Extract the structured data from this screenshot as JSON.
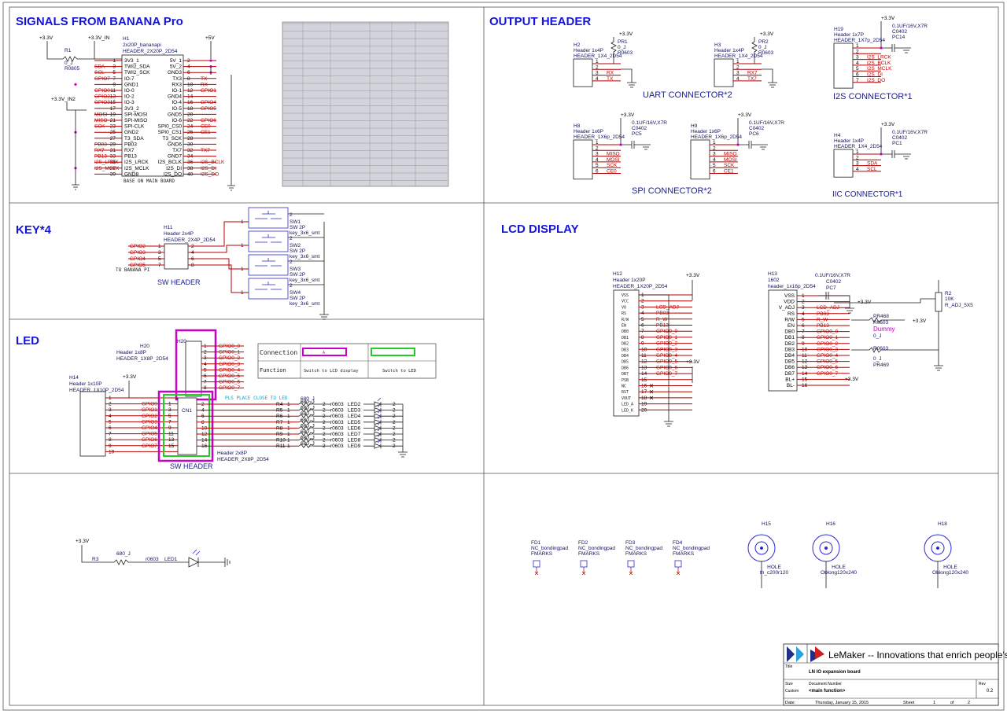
{
  "sections": {
    "signals": "SIGNALS FROM BANANA Pro",
    "output": "OUTPUT HEADER",
    "key": "KEY*4",
    "lcd": "LCD DISPLAY",
    "led": "LED"
  },
  "h1": {
    "ref": "H1",
    "val": "2x20P_bananapi",
    "fp": "HEADER_2X20P_2D54",
    "note": "BASE ON MAIN BOARD",
    "r1": [
      "R1",
      "0_J",
      "R0805"
    ],
    "power": [
      "+3.3V",
      "+3.3V_IN",
      "+5V",
      "+3.3V_IN2"
    ],
    "left": [
      {
        "n": "1",
        "p": "3V3_1",
        "s": ""
      },
      {
        "n": "3",
        "p": "TWI2_SDA",
        "s": "SDA"
      },
      {
        "n": "5",
        "p": "TWI2_SCK",
        "s": "SCL"
      },
      {
        "n": "7",
        "p": "IO-7",
        "s": "GPIO7"
      },
      {
        "n": "9",
        "p": "GND1",
        "s": ""
      },
      {
        "n": "11",
        "p": "IO-0",
        "s": "GPIO0"
      },
      {
        "n": "13",
        "p": "IO-2",
        "s": "GPIO2"
      },
      {
        "n": "15",
        "p": "IO-3",
        "s": "GPIO3"
      },
      {
        "n": "17",
        "p": "3V3_2",
        "s": ""
      },
      {
        "n": "19",
        "p": "SPI-MOSI",
        "s": "MOSI"
      },
      {
        "n": "21",
        "p": "SPI-MISO",
        "s": "MISO"
      },
      {
        "n": "23",
        "p": "SPI-CLK",
        "s": "SCK"
      },
      {
        "n": "25",
        "p": "GND2",
        "s": ""
      },
      {
        "n": "27",
        "p": "T3_SDA",
        "s": ""
      },
      {
        "n": "29",
        "p": "PB03",
        "s": "PB03"
      },
      {
        "n": "31",
        "p": "RX7",
        "s": "RX7"
      },
      {
        "n": "33",
        "p": "PB13",
        "s": "PB13"
      },
      {
        "n": "35",
        "p": "I2S_LRCK",
        "s": "I2S_LRCK"
      },
      {
        "n": "37",
        "p": "I2S_MCLK",
        "s": "I2S_MCLK"
      },
      {
        "n": "39",
        "p": "GND8",
        "s": ""
      }
    ],
    "right": [
      {
        "n": "2",
        "p": "5V_1",
        "s": ""
      },
      {
        "n": "4",
        "p": "5V_2",
        "s": ""
      },
      {
        "n": "6",
        "p": "GND3",
        "s": ""
      },
      {
        "n": "8",
        "p": "TX3",
        "s": "TX"
      },
      {
        "n": "10",
        "p": "RX3",
        "s": "RX"
      },
      {
        "n": "12",
        "p": "IO-1",
        "s": "GPIO1"
      },
      {
        "n": "14",
        "p": "GND4",
        "s": ""
      },
      {
        "n": "16",
        "p": "IO-4",
        "s": "GPIO4"
      },
      {
        "n": "18",
        "p": "IO-5",
        "s": "GPIO5"
      },
      {
        "n": "20",
        "p": "GND5",
        "s": ""
      },
      {
        "n": "22",
        "p": "IO-6",
        "s": "GPIO6"
      },
      {
        "n": "24",
        "p": "SPI0_CS0",
        "s": "CE0"
      },
      {
        "n": "26",
        "p": "SPI0_CS1",
        "s": "CE1"
      },
      {
        "n": "28",
        "p": "T3_SCK",
        "s": ""
      },
      {
        "n": "30",
        "p": "GND6",
        "s": ""
      },
      {
        "n": "32",
        "p": "TX7",
        "s": "TX7"
      },
      {
        "n": "34",
        "p": "GND7",
        "s": ""
      },
      {
        "n": "36",
        "p": "I2S_BCLK",
        "s": "I2S_BCLK"
      },
      {
        "n": "38",
        "p": "I2S_DI",
        "s": "I2S_DI"
      },
      {
        "n": "40",
        "p": "I2S_DO",
        "s": "I2S_DO"
      }
    ]
  },
  "output": {
    "uart": "UART CONNECTOR*2",
    "spi": "SPI CONNECTOR*2",
    "i2s": "I2S CONNECTOR*1",
    "iic": "IIC CONNECTOR*1",
    "h2": {
      "ref": "H2",
      "val": "Header 1x4P",
      "fp": "HEADER_1X4_2D54",
      "pr": [
        "PR1",
        "0_J",
        "R0603"
      ],
      "pins": [
        {
          "n": "1",
          "s": ""
        },
        {
          "n": "2",
          "s": ""
        },
        {
          "n": "3",
          "s": "RX"
        },
        {
          "n": "4",
          "s": "TX"
        }
      ]
    },
    "h3": {
      "ref": "H3",
      "val": "Header 1x4P",
      "fp": "HEADER_1X4_2D54",
      "pr": [
        "PR2",
        "0_J",
        "R0603"
      ],
      "pins": [
        {
          "n": "1",
          "s": ""
        },
        {
          "n": "2",
          "s": ""
        },
        {
          "n": "3",
          "s": "RX7"
        },
        {
          "n": "4",
          "s": "TX7"
        }
      ]
    },
    "h19": {
      "ref": "H19",
      "val": "Header 1x7P",
      "fp": "HEADER_1X7p_2D54",
      "cap": [
        "0.1UF/16V,X7R",
        "C0402",
        "PC14"
      ],
      "pins": [
        {
          "n": "1",
          "s": ""
        },
        {
          "n": "2",
          "s": ""
        },
        {
          "n": "3",
          "s": "I2S_LRCK"
        },
        {
          "n": "4",
          "s": "I2S_BCLK"
        },
        {
          "n": "5",
          "s": "I2S_MCLK"
        },
        {
          "n": "6",
          "s": "I2S_DI"
        },
        {
          "n": "7",
          "s": "I2S_DO"
        }
      ]
    },
    "h8": {
      "ref": "H8",
      "val": "Header 1x6P",
      "fp": "HEADER_1X6p_2D54",
      "cap": [
        "0.1UF/16V,X7R",
        "C0402",
        "PC5"
      ],
      "pins": [
        {
          "n": "1",
          "s": ""
        },
        {
          "n": "2",
          "s": ""
        },
        {
          "n": "3",
          "s": "MISO"
        },
        {
          "n": "4",
          "s": "MOSI"
        },
        {
          "n": "5",
          "s": "SCK"
        },
        {
          "n": "6",
          "s": "CE0"
        }
      ]
    },
    "h9": {
      "ref": "H9",
      "val": "Header 1x6P",
      "fp": "HEADER_1X6p_2D54",
      "cap": [
        "0.1UF/16V,X7R",
        "C0402",
        "PC6"
      ],
      "pins": [
        {
          "n": "1",
          "s": ""
        },
        {
          "n": "2",
          "s": ""
        },
        {
          "n": "3",
          "s": "MISO"
        },
        {
          "n": "4",
          "s": "MOSI"
        },
        {
          "n": "5",
          "s": "SCK"
        },
        {
          "n": "6",
          "s": "CE1"
        }
      ]
    },
    "h4": {
      "ref": "H4",
      "val": "Header 1x4P",
      "fp": "HEADER_1X4_2D54",
      "cap": [
        "0.1UF/16V,X7R",
        "C0402",
        "PC1"
      ],
      "pins": [
        {
          "n": "1",
          "s": ""
        },
        {
          "n": "2",
          "s": ""
        },
        {
          "n": "3",
          "s": "SDA"
        },
        {
          "n": "4",
          "s": "SCL"
        }
      ]
    }
  },
  "key": {
    "h11": {
      "ref": "H11",
      "val": "Header 2x4P",
      "fp": "HEADER_2X4P_2D54",
      "title": "SW HEADER",
      "note": "TO BANANA PI"
    },
    "gpio": [
      "GPIO2",
      "GPIO3",
      "GPIO4",
      "GPIO5"
    ],
    "sw": [
      {
        "ref": "SW1",
        "val": "SW 2P",
        "fp": "key_3x6_smt"
      },
      {
        "ref": "SW2",
        "val": "SW 2P",
        "fp": "key_3x6_smt"
      },
      {
        "ref": "SW3",
        "val": "SW 2P",
        "fp": "key_3x6_smt"
      },
      {
        "ref": "SW4",
        "val": "SW 2P",
        "fp": "key_3x6_smt"
      }
    ]
  },
  "lcd": {
    "h12": {
      "ref": "H12",
      "val": "Header 1x20P",
      "fp": "HEADER_1X20P_2D54",
      "pins": [
        "VSS",
        "VCC",
        "VO",
        "RS",
        "R/W",
        "EN",
        "DB0",
        "DB1",
        "DB2",
        "DB3",
        "DB4",
        "DB5",
        "DB6",
        "DB7",
        "PSB",
        "NC",
        "RST",
        "VOUT",
        "LED_A",
        "LED_K"
      ],
      "sig": [
        "",
        "",
        "LCD_ADJ",
        "PB03",
        "R_W",
        "PB13",
        "GPIO0_0",
        "GPIO0_1",
        "GPIO0_2",
        "GPIO0_3",
        "GPIO0_4",
        "GPIO0_5",
        "GPIO0_6",
        "GPIO0_7",
        "",
        "",
        "",
        "",
        "",
        ""
      ]
    },
    "h13": {
      "ref": "H13",
      "val": "1602",
      "fp": "header_1x16p_2D54",
      "cap": [
        "0.1UF/16V,X7R",
        "C0402",
        "PC7"
      ],
      "pins": [
        "VSS",
        "VDD",
        "V_ADJ",
        "RS",
        "R/W",
        "EN",
        "DB0",
        "DB1",
        "DB2",
        "DB3",
        "DB4",
        "DB5",
        "DB6",
        "DB7",
        "BL+",
        "BL-"
      ],
      "sig": [
        "",
        "",
        "LCD_ADJ",
        "PB03",
        "R_W",
        "PB13",
        "GPIO0_0",
        "GPIO0_1",
        "GPIO0_2",
        "GPIO0_3",
        "GPIO0_4",
        "GPIO0_5",
        "GPIO0_6",
        "GPIO0_7",
        "",
        ""
      ]
    },
    "r2": [
      "R2",
      "10K",
      "R_ADJ_5X5"
    ],
    "pr468": [
      "PR468",
      "R0603",
      "Dummy",
      "0_J"
    ],
    "pr469": [
      "R0603",
      "0_J",
      "PR469"
    ]
  },
  "led": {
    "h20": {
      "ref": "H20",
      "val": "Header 1x8P",
      "fp": "HEADER_1X8P_2D54"
    },
    "h20sig": [
      "GPIO0_0",
      "GPIO0_1",
      "GPIO0_2",
      "GPIO0_3",
      "GPIO0_4",
      "GPIO0_5",
      "GPIO0_6",
      "GPIO0_7"
    ],
    "h14": {
      "ref": "H14",
      "val": "Header 1x10P",
      "fp": "HEADER_1X10P_2D54"
    },
    "h14sig": [
      "GPIO0",
      "GPIO1",
      "GPIO2",
      "GPIO3",
      "GPIO4",
      "GPIO5",
      "GPIO6",
      "GPIO7"
    ],
    "cn1": {
      "ref": "CN1",
      "val": "Header 2x8P",
      "fp": "HEADER_2X8P_2D54",
      "title": "SW HEADER"
    },
    "note": "PLS PLACE CLOSE TO LED",
    "rval": "680_J",
    "res": [
      "R4",
      "R5",
      "R6",
      "R7",
      "R8",
      "R9",
      "R10",
      "R11"
    ],
    "leds": [
      "LED2",
      "LED3",
      "LED4",
      "LED5",
      "LED6",
      "LED7",
      "LED8",
      "LED9"
    ],
    "table": {
      "c1": "Connection",
      "c2": "Function",
      "f1": "Switch to LCD display",
      "f2": "Switch to LED",
      "mark": "A"
    }
  },
  "led1": [
    "+3.3V",
    "R3",
    "680_J",
    "r0603",
    "LED1"
  ],
  "marks": [
    {
      "ref": "FD1",
      "val": "NC_bondingpad",
      "fp": "FMARKS"
    },
    {
      "ref": "FD2",
      "val": "NC_bondingpad",
      "fp": "FMARKS"
    },
    {
      "ref": "FD3",
      "val": "NC_bondingpad",
      "fp": "FMARKS"
    },
    {
      "ref": "FD4",
      "val": "NC_bondingpad",
      "fp": "FMARKS"
    }
  ],
  "holes": [
    {
      "ref": "H15",
      "val": "HOLE",
      "fp": "th_c200r120"
    },
    {
      "ref": "H16",
      "val": "HOLE",
      "fp": "Oblong120x240"
    },
    {
      "ref": "H18",
      "val": "HOLE",
      "fp": "Oblong120x240"
    }
  ],
  "titleblock": {
    "company": "LeMaker -- Innovations that enrich people's lives",
    "title_lbl": "Title",
    "title": "LN IO expansion board",
    "size_lbl": "Size",
    "size": "Custom",
    "doc_lbl": "Document Number",
    "doc": "<main function>",
    "rev_lbl": "Rev",
    "rev": "0.2",
    "date_lbl": "Date:",
    "date": "Thursday, January 15, 2015",
    "sheet_lbl": "Sheet",
    "sheet": "1",
    "of_lbl": "of",
    "of": "2"
  },
  "colors": {
    "title": "#1515d8",
    "wire": "#b40000",
    "highlight_a": "#c800c8",
    "highlight_b": "#22cc22"
  }
}
